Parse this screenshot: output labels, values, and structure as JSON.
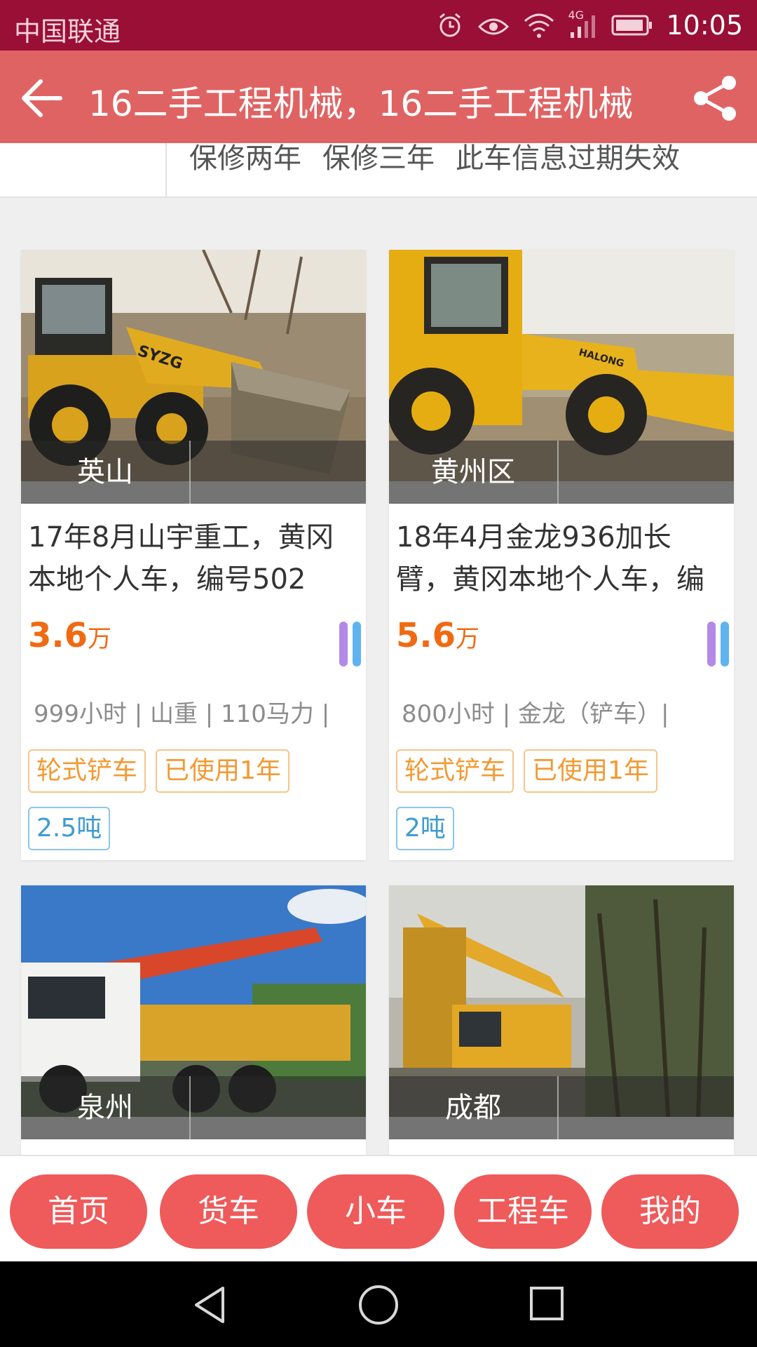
{
  "status_bar": {
    "carrier": "中国联通",
    "network": "4G",
    "time": "10:05"
  },
  "header": {
    "title": "16二手工程机械，16二手工程机械"
  },
  "filter_strip": {
    "options": [
      "保修两年",
      "保修三年",
      "此车信息过期失效"
    ]
  },
  "listings": [
    {
      "location": "英山",
      "title": "17年8月山宇重工，黄冈本地个人车，编号502",
      "price": "3.6",
      "price_unit": "万",
      "specs": "999小时 | 山重 | 110马力 |",
      "tags_orange": [
        "轮式铲车",
        "已使用1年"
      ],
      "tags_blue": [
        "2.5吨"
      ]
    },
    {
      "location": "黄州区",
      "title": "18年4月金龙936加长臂，黄冈本地个人车，编",
      "price": "5.6",
      "price_unit": "万",
      "specs": "800小时 | 金龙（铲车）|",
      "tags_orange": [
        "轮式铲车",
        "已使用1年"
      ],
      "tags_blue": [
        "2吨"
      ]
    },
    {
      "location": "泉州"
    },
    {
      "location": "成都"
    }
  ],
  "bottom_nav": [
    "首页",
    "货车",
    "小车",
    "工程车",
    "我的"
  ],
  "colors": {
    "status_bar": "#990f36",
    "header": "#e06363",
    "price": "#f06a12",
    "nav_pill": "#ef5a5a"
  }
}
